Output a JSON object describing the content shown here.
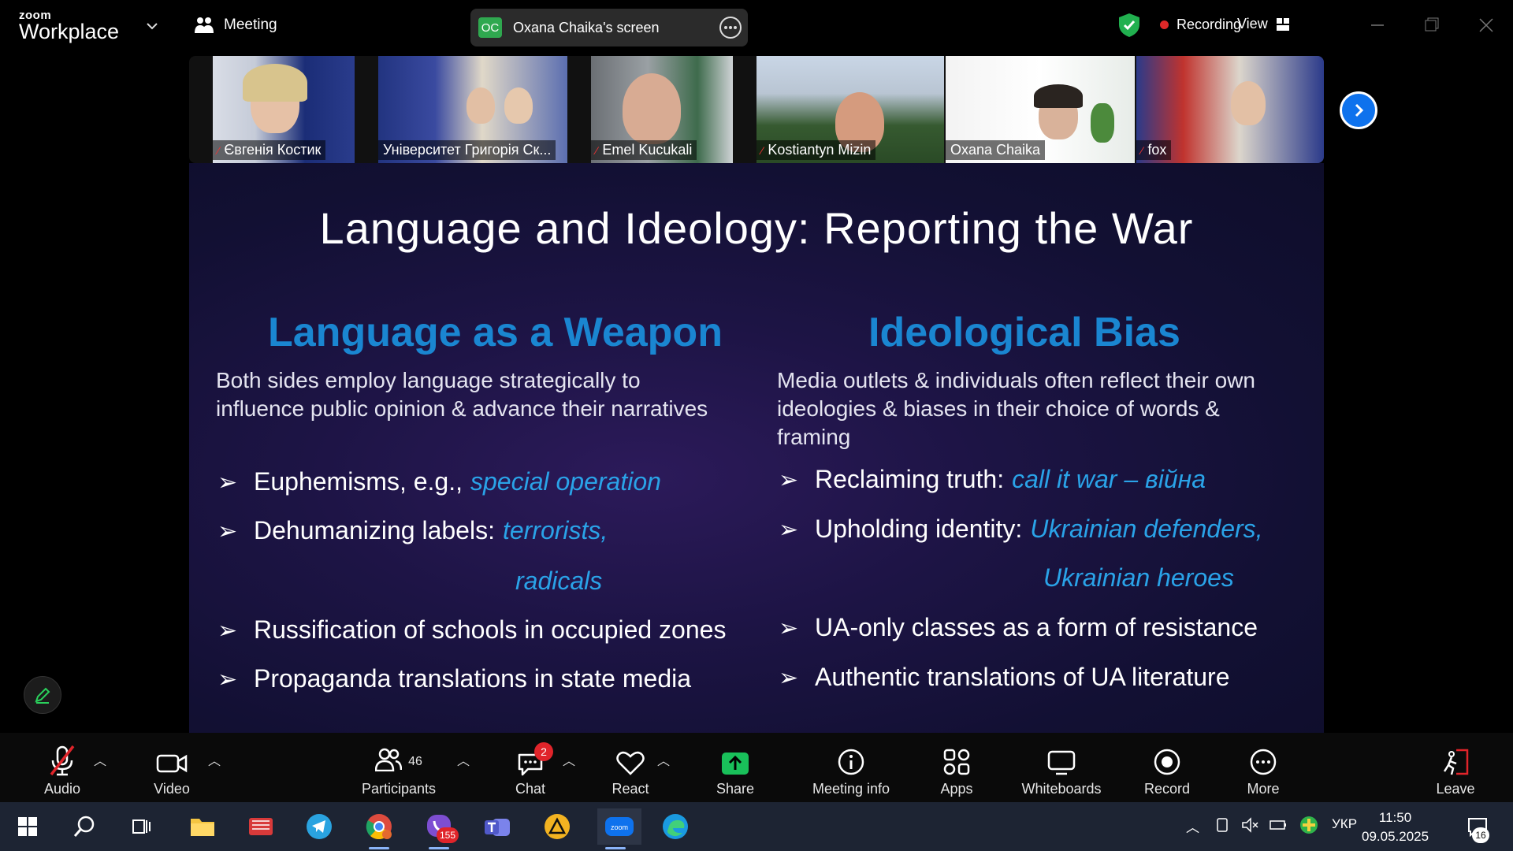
{
  "app": {
    "logo_top": "zoom",
    "logo_bottom": "Workplace",
    "meeting_label": "Meeting",
    "screen_owner_initials": "OC",
    "screen_owner_label": "Oxana Chaika's screen",
    "recording_label": "Recording",
    "view_label": "View"
  },
  "participants_strip": [
    {
      "name": "Євгенія Костик",
      "muted": true,
      "active": false
    },
    {
      "name": "Університет Григорія Ск...",
      "muted": false,
      "active": false
    },
    {
      "name": "Emel Kucukali",
      "muted": true,
      "active": false
    },
    {
      "name": "Kostiantyn Mizin",
      "muted": true,
      "active": false
    },
    {
      "name": "Oxana Chaika",
      "muted": false,
      "active": true
    },
    {
      "name": "fox",
      "muted": true,
      "active": false
    }
  ],
  "slide": {
    "title": "Language and Ideology: Reporting the War",
    "left": {
      "heading": "Language as a Weapon",
      "intro_1": "Both sides employ language strategically to",
      "intro_2": "influence public opinion & advance their narratives",
      "b1_text": "Euphemisms, e.g.,",
      "b1_em": "special operation",
      "b2_text": "Dehumanizing labels:",
      "b2_em": "terrorists,",
      "b2_em2": "radicals",
      "b3_text": "Russification of schools  in occupied zones",
      "b4_text": "Propaganda translations in state media"
    },
    "right": {
      "heading": "Ideological Bias",
      "intro_1": "Media outlets & individuals often reflect their own",
      "intro_2": "ideologies & biases in their choice of words &",
      "intro_3": "framing",
      "b1_text": "Reclaiming truth:",
      "b1_em": "call it war – війна",
      "b2_text": "Upholding identity:",
      "b2_em": "Ukrainian defenders,",
      "b2_em2": "Ukrainian  heroes",
      "b3_text": "UA-only classes as a form of resistance",
      "b4_text": "Authentic translations of UA literature"
    }
  },
  "toolbar": {
    "audio": "Audio",
    "video": "Video",
    "participants": "Participants",
    "participants_count": "46",
    "chat": "Chat",
    "chat_badge": "2",
    "react": "React",
    "share": "Share",
    "meeting_info": "Meeting info",
    "apps": "Apps",
    "whiteboards": "Whiteboards",
    "record": "Record",
    "more": "More",
    "leave": "Leave"
  },
  "taskbar": {
    "viber_badge": "155",
    "lang": "УКР",
    "time": "11:50",
    "date": "09.05.2025",
    "notif_count": "16"
  },
  "colors": {
    "zoom_blue": "#0e72ed",
    "slide_heading": "#1a86d1",
    "slide_emphasis": "#2aa3e8",
    "active_speaker": "#2ad15c",
    "share_green": "#19c05a",
    "badge_red": "#e0242a"
  }
}
